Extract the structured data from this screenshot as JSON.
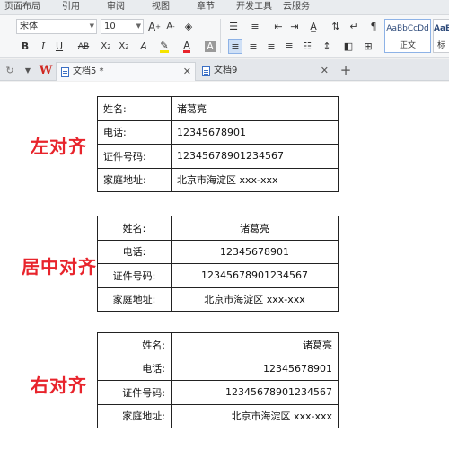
{
  "menu": [
    "页面布局",
    "引用",
    "审阅",
    "视图",
    "章节",
    "开发工具",
    "云服务"
  ],
  "ribbon": {
    "font_name": "宋体",
    "font_size": "10",
    "style_samples": [
      {
        "sample": "AaBbCcDd",
        "name": "正文"
      },
      {
        "sample": "AaB",
        "name": "标"
      }
    ],
    "colors": {
      "font_color": "#e8242c",
      "highlight": "#f5e400",
      "accent": "#3b6fc4"
    }
  },
  "tabs": [
    {
      "label": "文档5 *",
      "active": true
    },
    {
      "label": "文档9",
      "active": false
    }
  ],
  "document": {
    "sections": [
      {
        "label": "左对齐",
        "align": "left",
        "rows": [
          {
            "key": "姓名:",
            "value": "诸葛亮"
          },
          {
            "key": "电话:",
            "value": "12345678901"
          },
          {
            "key": "证件号码:",
            "value": "12345678901234567"
          },
          {
            "key": "家庭地址:",
            "value": "北京市海淀区 xxx-xxx"
          }
        ]
      },
      {
        "label": "居中对齐",
        "align": "center",
        "rows": [
          {
            "key": "姓名:",
            "value": "诸葛亮"
          },
          {
            "key": "电话:",
            "value": "12345678901"
          },
          {
            "key": "证件号码:",
            "value": "12345678901234567"
          },
          {
            "key": "家庭地址:",
            "value": "北京市海淀区 xxx-xxx"
          }
        ]
      },
      {
        "label": "右对齐",
        "align": "right",
        "rows": [
          {
            "key": "姓名:",
            "value": "诸葛亮"
          },
          {
            "key": "电话:",
            "value": "12345678901"
          },
          {
            "key": "证件号码:",
            "value": "12345678901234567"
          },
          {
            "key": "家庭地址:",
            "value": "北京市海淀区 xxx-xxx"
          }
        ]
      }
    ]
  }
}
